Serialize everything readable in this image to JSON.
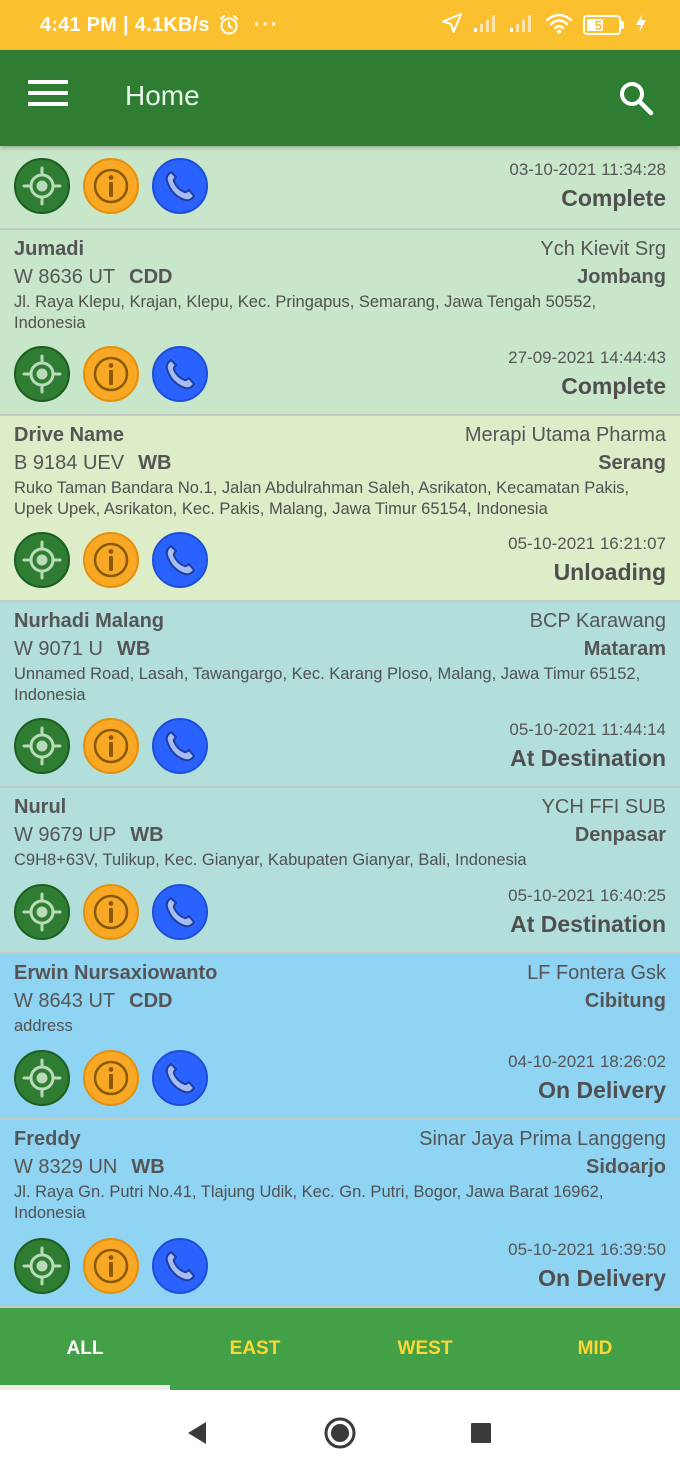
{
  "status_bar": {
    "time": "4:41 PM",
    "separator": "|",
    "speed": "4.1KB/s",
    "more": "···",
    "battery": "52"
  },
  "app_bar": {
    "title": "Home",
    "menu_icon": "hamburger-menu-icon",
    "search_icon": "search-icon"
  },
  "colors": {
    "status_bar": "#fbc02d",
    "app_bar": "#2e7d32",
    "tab_bar": "#43a047",
    "complete": "#c8e6c9",
    "unloading": "#dcedc8",
    "at_destination": "#b2dfdb",
    "on_delivery": "#90d4f4"
  },
  "action_buttons": {
    "location_icon": "gps-target-icon",
    "info_icon": "info-icon",
    "call_icon": "phone-icon"
  },
  "orders": [
    {
      "timestamp": "03-10-2021 11:34:28",
      "status": "Complete"
    },
    {
      "driver": "Jumadi",
      "customer": "Ych Kievit Srg",
      "plate": "W 8636 UT",
      "vehicle_type": "CDD",
      "city": "Jombang",
      "address": "Jl. Raya Klepu, Krajan, Klepu, Kec. Pringapus, Semarang, Jawa Tengah 50552, Indonesia",
      "timestamp": "27-09-2021 14:44:43",
      "status": "Complete"
    },
    {
      "driver": "Drive Name",
      "customer": "Merapi Utama Pharma",
      "plate": "B 9184 UEV",
      "vehicle_type": "WB",
      "city": "Serang",
      "address": "Ruko Taman Bandara No.1, Jalan Abdulrahman Saleh, Asrikaton, Kecamatan Pakis, Upek Upek, Asrikaton, Kec. Pakis, Malang, Jawa Timur 65154, Indonesia",
      "timestamp": "05-10-2021 16:21:07",
      "status": "Unloading"
    },
    {
      "driver": "Nurhadi Malang",
      "customer": "BCP Karawang",
      "plate": "W 9071 U",
      "vehicle_type": "WB",
      "city": "Mataram",
      "address": "Unnamed Road, Lasah, Tawangargo, Kec. Karang Ploso, Malang, Jawa Timur 65152, Indonesia",
      "timestamp": "05-10-2021 11:44:14",
      "status": "At Destination"
    },
    {
      "driver": "Nurul",
      "customer": "YCH FFI SUB",
      "plate": "W 9679 UP",
      "vehicle_type": "WB",
      "city": "Denpasar",
      "address": "C9H8+63V, Tulikup, Kec. Gianyar, Kabupaten Gianyar, Bali, Indonesia",
      "timestamp": "05-10-2021 16:40:25",
      "status": "At Destination"
    },
    {
      "driver": "Erwin  Nursaxiowanto",
      "customer": "LF Fontera Gsk",
      "plate": "W 8643 UT",
      "vehicle_type": "CDD",
      "city": "Cibitung",
      "address": "address",
      "timestamp": "04-10-2021 18:26:02",
      "status": "On Delivery"
    },
    {
      "driver": "Freddy",
      "customer": "Sinar Jaya Prima Langgeng",
      "plate": "W 8329 UN",
      "vehicle_type": "WB",
      "city": "Sidoarjo",
      "address": "Jl. Raya Gn. Putri No.41, Tlajung Udik, Kec. Gn. Putri, Bogor, Jawa Barat 16962, Indonesia",
      "timestamp": "05-10-2021 16:39:50",
      "status": "On Delivery"
    }
  ],
  "tabs": [
    {
      "label": "ALL",
      "active": true
    },
    {
      "label": "EAST",
      "active": false
    },
    {
      "label": "WEST",
      "active": false
    },
    {
      "label": "MID",
      "active": false
    }
  ],
  "nav_bar": {
    "back_icon": "back-triangle-icon",
    "home_icon": "home-circle-icon",
    "recents_icon": "recents-square-icon"
  }
}
